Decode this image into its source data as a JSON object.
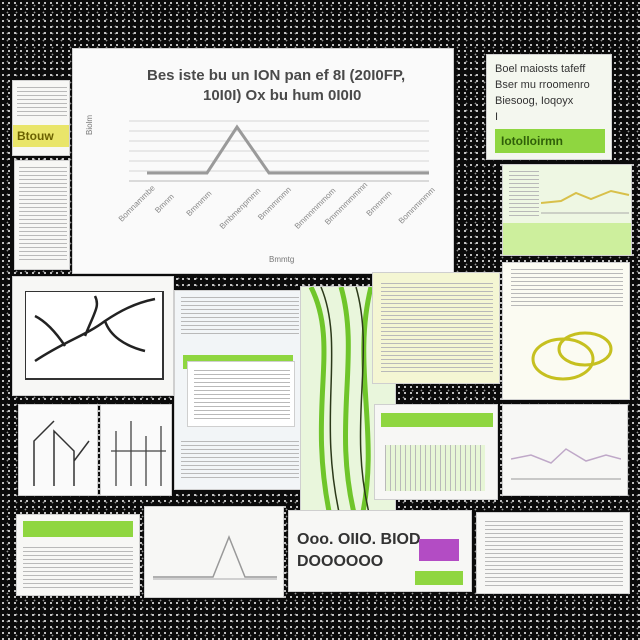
{
  "main_chart": {
    "title_line1": "Bes iste bu un ION pan ef 8I (20I0FP,",
    "title_line2": "10I0I) Ox bu hum 0I0I0",
    "ylabel": "Biolm",
    "xlabel": "Bmmtg",
    "tick_labels": [
      "Bomnammbe",
      "Bmnm",
      "Bmmmm",
      "Bmbmenpmmn",
      "Bmmmmmn",
      "Bmmnmmmom",
      "Bmmmmmmmn",
      "Bmmmm",
      "Bomnmmmm"
    ]
  },
  "right_top_card": {
    "lines": [
      "Boel maiosts tafeff",
      "Bser mu rroomenro",
      "Biesoog, Ioqoyx",
      "I"
    ],
    "badge": "Iotolloirmn"
  },
  "bottom_card": {
    "text_line1": "Ooo. OIIO. BIOD",
    "text_line2": "DOOOOOO"
  },
  "colors": {
    "accent_green": "#8fd640",
    "light_green": "#cdef9d",
    "yellow": "#e9e56a",
    "purple": "#b34cc4",
    "line_gray": "#9a9a9a"
  }
}
